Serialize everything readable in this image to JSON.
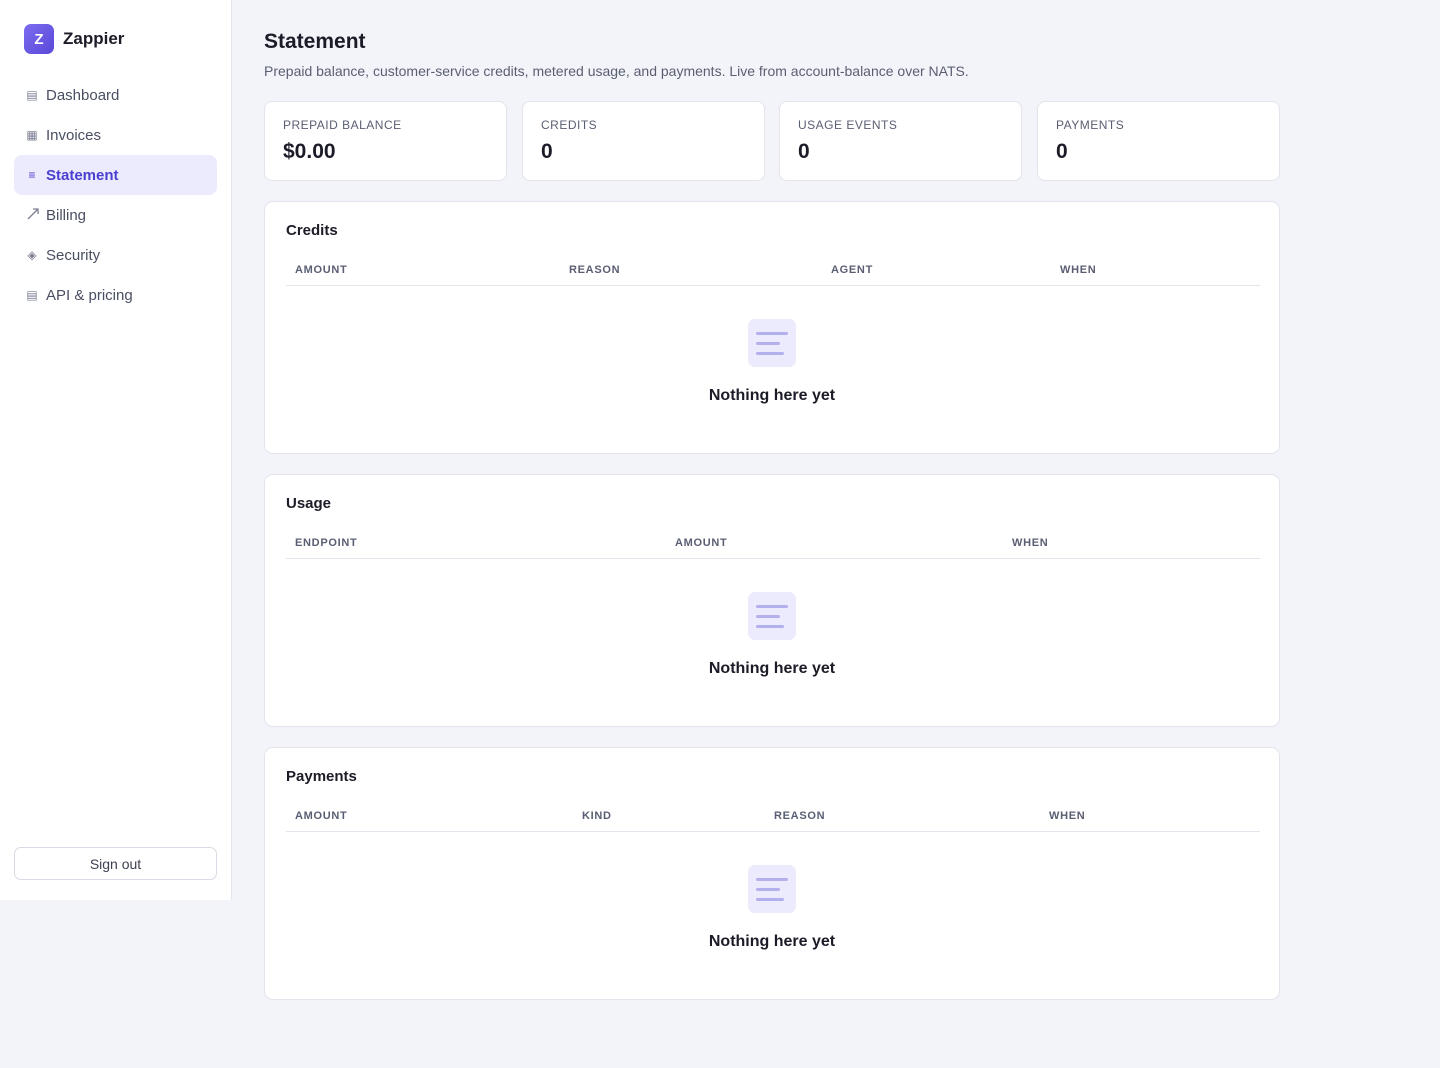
{
  "brand": {
    "logo_letter": "Z",
    "name": "Zappier"
  },
  "sidebar": {
    "items": [
      {
        "label": "Dashboard",
        "icon": "list-icon",
        "active": false
      },
      {
        "label": "Invoices",
        "icon": "grid-icon",
        "active": false
      },
      {
        "label": "Statement",
        "icon": "lines-icon",
        "active": true
      },
      {
        "label": "Billing",
        "icon": "trend-arrow-icon",
        "active": false
      },
      {
        "label": "Security",
        "icon": "diamond-icon",
        "active": false
      },
      {
        "label": "API & pricing",
        "icon": "list-icon",
        "active": false
      }
    ],
    "signout_label": "Sign out"
  },
  "header": {
    "title": "Statement",
    "subtitle": "Prepaid balance, customer-service credits, metered usage, and payments. Live from account-balance over NATS."
  },
  "stats": [
    {
      "label": "PREPAID BALANCE",
      "value": "$0.00"
    },
    {
      "label": "CREDITS",
      "value": "0"
    },
    {
      "label": "USAGE EVENTS",
      "value": "0"
    },
    {
      "label": "PAYMENTS",
      "value": "0"
    }
  ],
  "panels": {
    "credits": {
      "title": "Credits",
      "columns": [
        "AMOUNT",
        "REASON",
        "AGENT",
        "WHEN"
      ],
      "empty_text": "Nothing here yet"
    },
    "usage": {
      "title": "Usage",
      "columns": [
        "ENDPOINT",
        "AMOUNT",
        "WHEN"
      ],
      "empty_text": "Nothing here yet"
    },
    "payments": {
      "title": "Payments",
      "columns": [
        "AMOUNT",
        "KIND",
        "REASON",
        "WHEN"
      ],
      "empty_text": "Nothing here yet"
    }
  },
  "colors": {
    "accent": "#4b3fd0",
    "active_bg": "#ebebfd",
    "page_bg": "#f3f4f9"
  }
}
